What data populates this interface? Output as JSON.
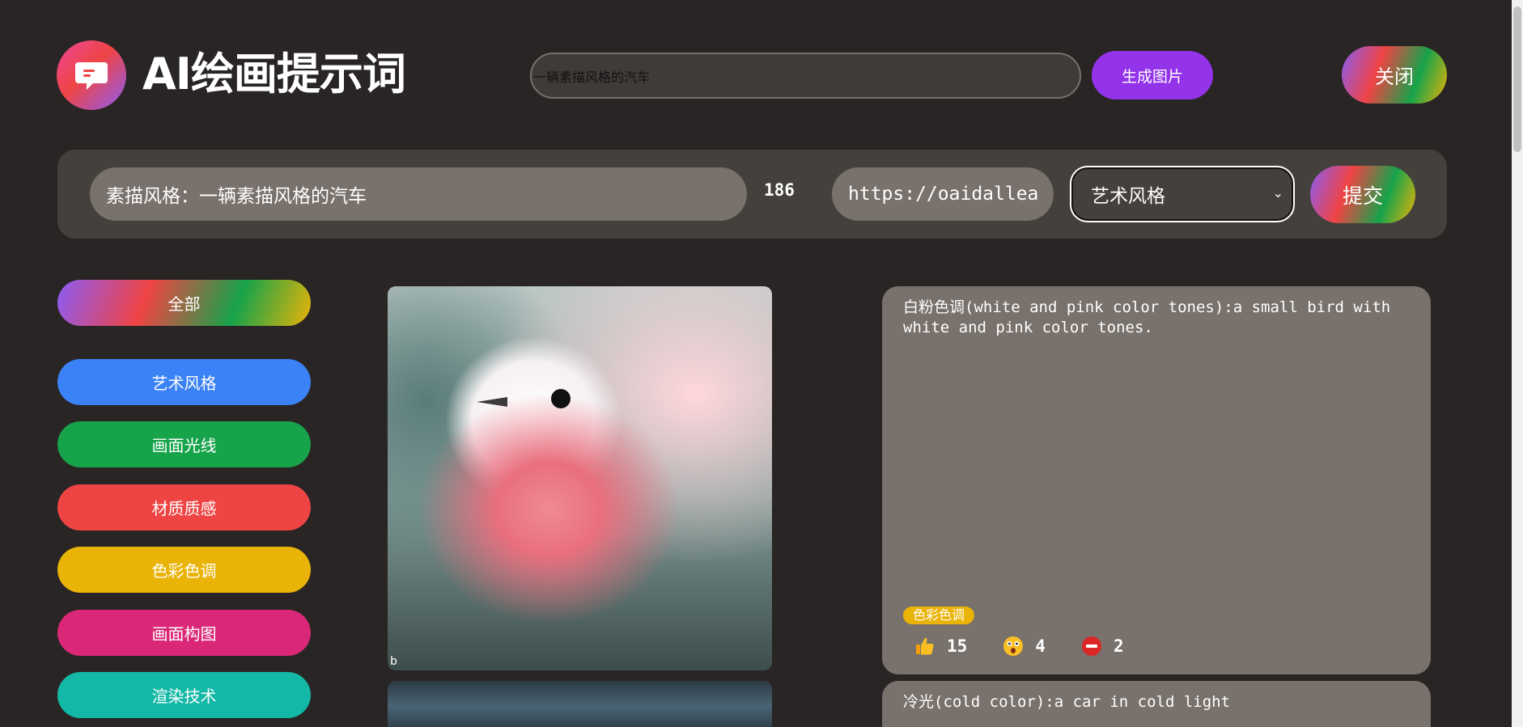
{
  "header": {
    "logo_icon": "chat-bubble-icon",
    "brand_title": "AI绘画提示词",
    "search_value": "一辆素描风格的汽车",
    "generate_label": "生成图片",
    "close_label": "关闭"
  },
  "submit_bar": {
    "prompt_value": "素描风格：一辆素描风格的汽车",
    "char_count": "186",
    "url_value": "https://oaidallea",
    "style_selected": "艺术风格",
    "submit_label": "提交"
  },
  "categories": [
    {
      "label": "全部",
      "color": "gradient"
    },
    {
      "label": "艺术风格",
      "color": "#3b82f6"
    },
    {
      "label": "画面光线",
      "color": "#16a34a"
    },
    {
      "label": "材质质感",
      "color": "#ef4444"
    },
    {
      "label": "色彩色调",
      "color": "#eab308"
    },
    {
      "label": "画面构图",
      "color": "#db2777"
    },
    {
      "label": "渲染技术",
      "color": "#14b8a6"
    }
  ],
  "gallery": [
    {
      "image": "pink-white-bird-image",
      "watermark": "b",
      "prompt": "白粉色调(white and pink color tones):a small bird with white and pink color tones.",
      "tag": "色彩色调",
      "tag_color": "#eab308",
      "reactions": {
        "like": "15",
        "surprised": "4",
        "forbidden": "2"
      }
    },
    {
      "image": "car-cold-light-image",
      "prompt": "冷光(cold color):a car in cold light"
    }
  ]
}
